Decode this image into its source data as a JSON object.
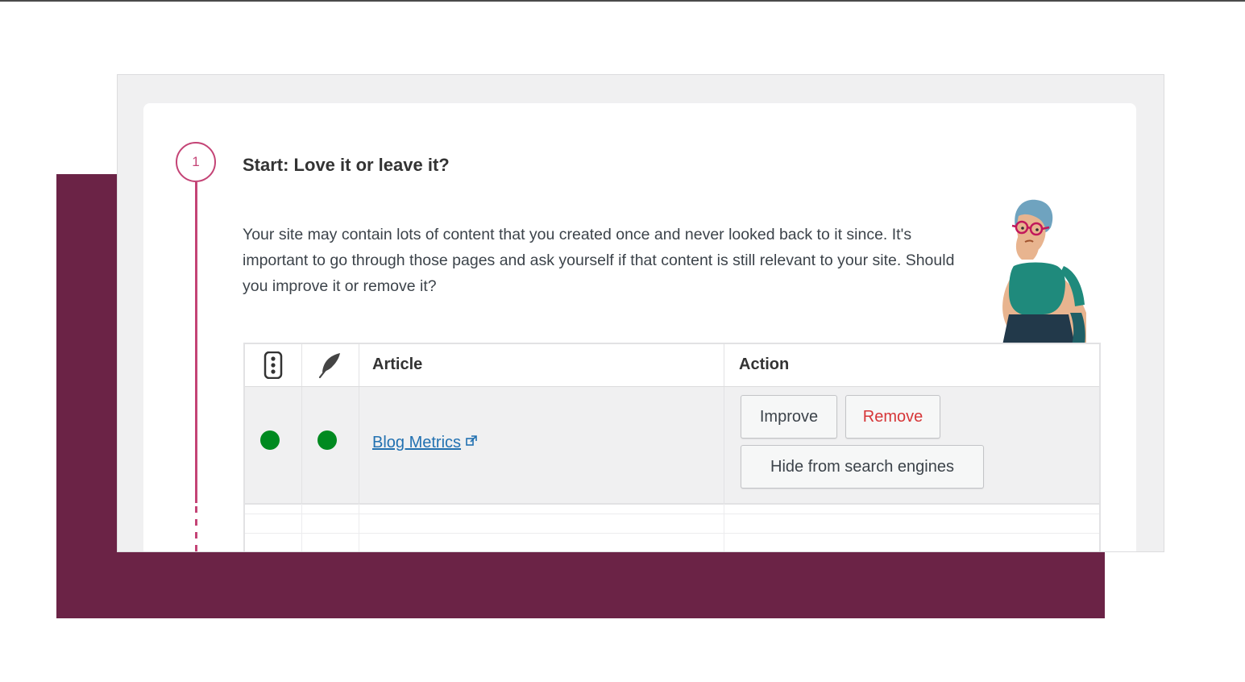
{
  "step": {
    "number": "1",
    "title": "Start: Love it or leave it?",
    "description": "Your site may contain lots of content that you created once and never looked back to it since. It's important to go through those pages and ask yourself if that content is still relevant to your site. Should you improve it or remove it?"
  },
  "table": {
    "columns": {
      "readability_icon": "traffic-light-icon",
      "seo_icon": "feather-icon",
      "article": "Article",
      "action": "Action"
    },
    "rows": [
      {
        "readability_status": "good",
        "seo_status": "good",
        "article_title": "Blog Metrics",
        "actions": {
          "improve": "Improve",
          "remove": "Remove",
          "hide": "Hide from search engines"
        }
      }
    ]
  },
  "colors": {
    "brand_plum": "#6b2346",
    "step_pink": "#c44476",
    "status_good": "#008a20",
    "link_blue": "#2271b1",
    "remove_red": "#d63638"
  }
}
